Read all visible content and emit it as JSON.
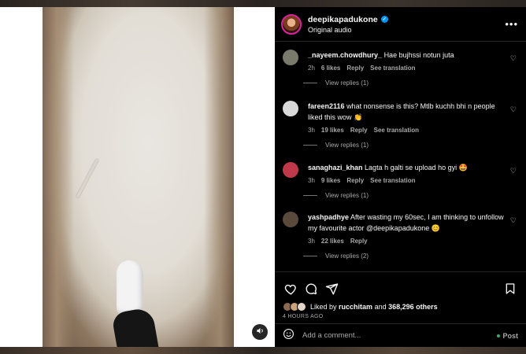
{
  "post": {
    "username": "deepikapadukone",
    "audio": "Original audio",
    "more_label": "•••"
  },
  "comments": [
    {
      "user": "_nayeem.chowdhury_",
      "text": "Hae bujhssi notun juta",
      "age": "2h",
      "likes": "6 likes",
      "reply": "Reply",
      "translate": "See translation",
      "view_replies": "View replies (1)",
      "avatar_color": "#7a7a6a"
    },
    {
      "user": "fareen2116",
      "text": "what nonsense is this? Mtlb kuchh bhi n people liked this wow 👏",
      "age": "3h",
      "likes": "19 likes",
      "reply": "Reply",
      "translate": "See translation",
      "view_replies": "View replies (1)",
      "avatar_color": "#d9d9d9"
    },
    {
      "user": "sanaghazi_khan",
      "text": "Lagta h galti se upload ho gyi 🤩",
      "age": "3h",
      "likes": "9 likes",
      "reply": "Reply",
      "translate": "See translation",
      "view_replies": "View replies (1)",
      "avatar_color": "#c0394b"
    },
    {
      "user": "yashpadhye",
      "text": "After wasting my 60sec, I am thinking to unfollow my favourite actor @deepikapadukone 😊",
      "age": "3h",
      "likes": "22 likes",
      "reply": "Reply",
      "translate": "",
      "view_replies": "View replies (2)",
      "avatar_color": "#5a4a3c"
    }
  ],
  "likes": {
    "prefix": "Liked by",
    "user": "rucchitam",
    "and": "and",
    "count": "368,296 others"
  },
  "timestamp": "4 HOURS AGO",
  "add_comment": {
    "placeholder": "Add a comment...",
    "post_label": "Post"
  },
  "colors": {
    "accent": "#0095f6",
    "background": "#000000",
    "muted": "#a8a8a8"
  }
}
